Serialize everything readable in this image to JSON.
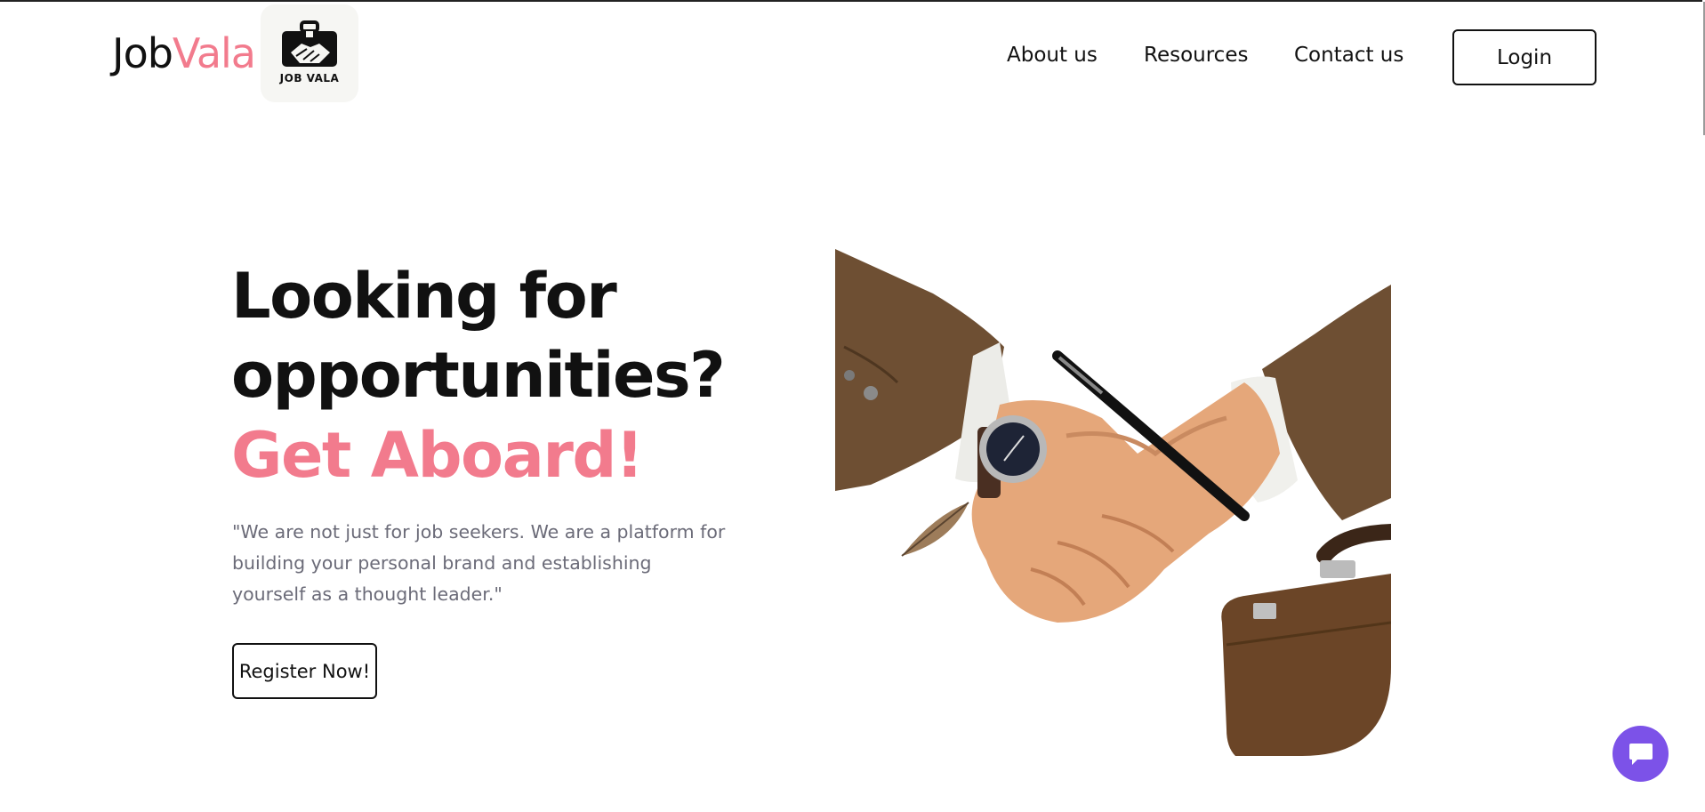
{
  "brand": {
    "logo_part1": "Job",
    "logo_part2": "Vala",
    "badge_label": "JOB VALA",
    "accent_color": "#f27b8d"
  },
  "nav": {
    "about": "About us",
    "resources": "Resources",
    "contact": "Contact us",
    "login": "Login"
  },
  "hero": {
    "line1": "Looking for",
    "line2": "opportunities?",
    "line3": "Get Aboard!",
    "quote": "\"We are not just for job seekers. We are a platform for building your personal brand and establishing yourself as a thought leader.\"",
    "register": "Register Now!",
    "image_icon": "handshake-image"
  },
  "chat": {
    "icon": "chat-bubble-icon",
    "color": "#7c52e8"
  }
}
